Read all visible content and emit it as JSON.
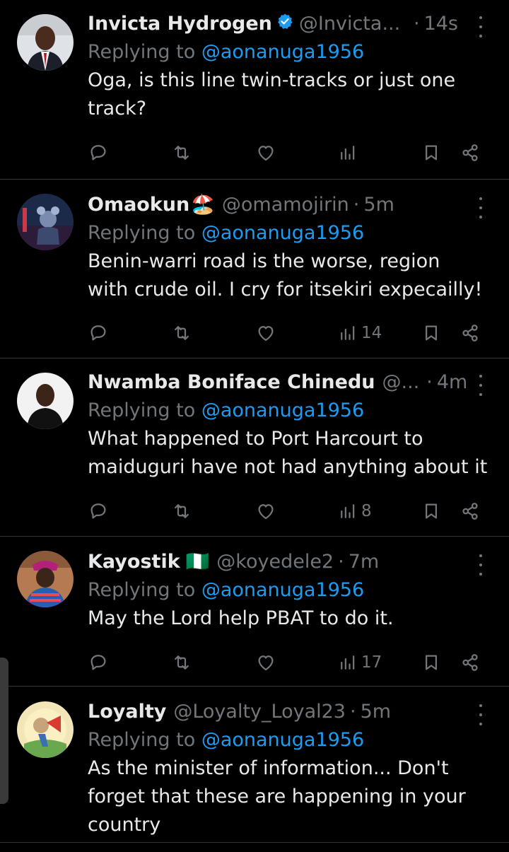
{
  "tweets": [
    {
      "name": "Invicta Hydrogen",
      "verified": true,
      "handle": "@Invicta...",
      "dot": "·",
      "time": "14s",
      "replying_prefix": "Replying to ",
      "replying_to": "@aonanuga1956",
      "text": "Oga, is this line twin-tracks or just one\ntrack?",
      "views": ""
    },
    {
      "name": "Omaokun",
      "emoji": "🏖️",
      "handle": "@omamojirin",
      "dot": "·",
      "time": "5m",
      "replying_prefix": "Replying to ",
      "replying_to": "@aonanuga1956",
      "text": "Benin-warri road is the worse, region\nwith crude oil. I cry for itsekiri expecailly!",
      "views": "14"
    },
    {
      "name": "Nwamba Boniface Chinedu",
      "handle": "@...",
      "dot": "·",
      "time": "4m",
      "replying_prefix": "Replying to ",
      "replying_to": "@aonanuga1956",
      "text": "What happened to Port Harcourt to\nmaiduguri have not had anything about it",
      "views": "8"
    },
    {
      "name": "Kayostik",
      "emoji": "🇳🇬",
      "handle": "@koyedele2",
      "dot": "·",
      "time": "7m",
      "replying_prefix": "Replying to ",
      "replying_to": "@aonanuga1956",
      "text": "May the Lord help PBAT to do it.",
      "views": "17"
    },
    {
      "name": "Loyalty",
      "handle": "@Loyalty_Loyal23",
      "dot": "·",
      "time": "5m",
      "replying_prefix": "Replying to ",
      "replying_to": "@aonanuga1956",
      "text": "As the minister of information... Don't\nforget that these are happening in your\ncountry",
      "views": ""
    }
  ],
  "icons": {
    "reply": "reply-icon",
    "retweet": "retweet-icon",
    "like": "heart-icon",
    "views": "views-icon",
    "bookmark": "bookmark-icon",
    "share": "share-icon",
    "more": "more-icon",
    "verified": "verified-badge-icon"
  },
  "colors": {
    "background": "#000000",
    "text": "#e7e9ea",
    "muted": "#71767b",
    "link": "#1d9bf0",
    "divider": "#2f3336"
  }
}
